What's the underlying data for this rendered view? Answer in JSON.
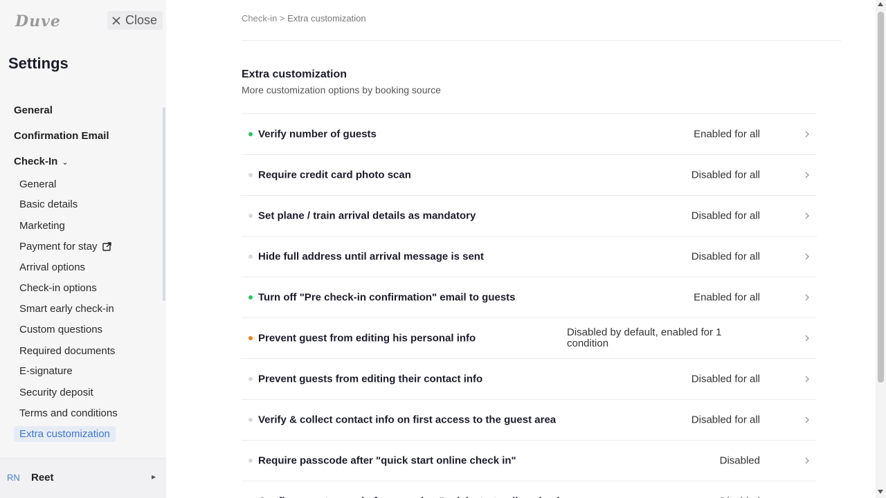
{
  "app": {
    "logo_text": "Duve"
  },
  "sidebar": {
    "close_label": "Close",
    "title": "Settings",
    "top_items": [
      {
        "label": "General"
      },
      {
        "label": "Confirmation Email"
      },
      {
        "label": "Check-In"
      }
    ],
    "checkin_items": [
      {
        "label": "General"
      },
      {
        "label": "Basic details"
      },
      {
        "label": "Marketing"
      },
      {
        "label": "Payment for stay",
        "icon": "external-link-icon"
      },
      {
        "label": "Arrival options"
      },
      {
        "label": "Check-in options"
      },
      {
        "label": "Smart early check-in"
      },
      {
        "label": "Custom questions"
      },
      {
        "label": "Required documents"
      },
      {
        "label": "E-signature"
      },
      {
        "label": "Security deposit"
      },
      {
        "label": "Terms and conditions"
      },
      {
        "label": "Extra customization",
        "active": true
      }
    ],
    "user": {
      "initials": "RN",
      "name": "Reet"
    }
  },
  "breadcrumb": {
    "parent": "Check-in",
    "separator": ">",
    "current": "Extra customization"
  },
  "section": {
    "title": "Extra customization",
    "subtitle": "More customization options by booking source"
  },
  "colors": {
    "enabled": "#27c26c",
    "partial": "#f07e1b",
    "disabled": "#d8d8d8",
    "accent": "#3e78c7"
  },
  "settings_rows": [
    {
      "label": "Verify number of guests",
      "status": "Enabled for all",
      "state": "enabled"
    },
    {
      "label": "Require credit card photo scan",
      "status": "Disabled for all",
      "state": "disabled"
    },
    {
      "label": "Set plane / train arrival details as mandatory",
      "status": "Disabled for all",
      "state": "disabled"
    },
    {
      "label": "Hide full address until arrival message is sent",
      "status": "Disabled for all",
      "state": "disabled"
    },
    {
      "label": "Turn off \"Pre check-in confirmation\" email to guests",
      "status": "Enabled for all",
      "state": "enabled"
    },
    {
      "label": "Prevent guest from editing his personal info",
      "status": "Disabled by default, enabled for 1 condition",
      "state": "partial"
    },
    {
      "label": "Prevent guests from editing their contact info",
      "status": "Disabled for all",
      "state": "disabled"
    },
    {
      "label": "Verify & collect contact info on first access to the guest area",
      "status": "Disabled for all",
      "state": "disabled"
    },
    {
      "label": "Require passcode after \"quick start online check in\"",
      "status": "Disabled",
      "state": "disabled"
    },
    {
      "label": "Confirm guest name before opening \"quick start online check-",
      "status": "Disabled",
      "state": "disabled"
    }
  ]
}
